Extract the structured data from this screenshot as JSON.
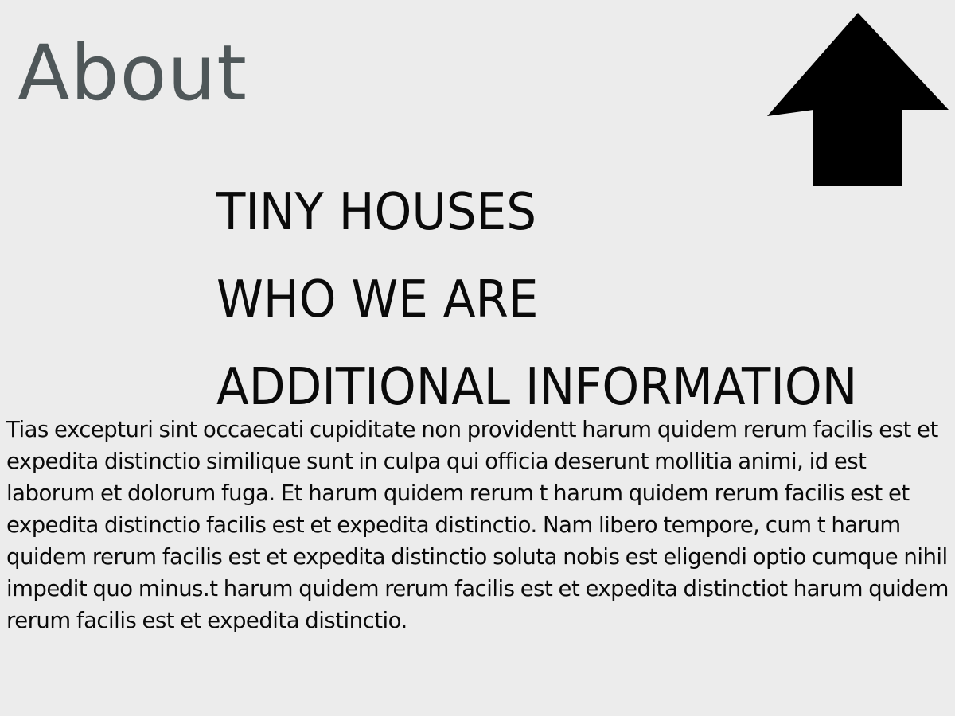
{
  "header": {
    "title": "About"
  },
  "icons": {
    "back_to_top": "arrow-up-icon",
    "arrow_color": "#000000"
  },
  "nav": {
    "items": [
      {
        "label": "TINY HOUSES"
      },
      {
        "label": "WHO WE ARE"
      },
      {
        "label": "ADDITIONAL INFORMATION"
      }
    ]
  },
  "content": {
    "paragraph": "Tias excepturi sint occaecati cupiditate non providentt harum quidem rerum facilis est et expedita distinctio similique sunt in culpa qui officia deserunt mollitia animi, id est laborum et dolorum fuga. Et harum quidem rerum t harum quidem rerum facilis est et expedita distinctio facilis est et expedita distinctio. Nam libero tempore, cum t harum quidem rerum  facilis est et expedita distinctio soluta nobis est eligendi optio cumque nihil impedit quo minus.t harum quidem rerum facilis est et expedita distinctiot harum quidem rerum facilis est et expedita distinctio."
  },
  "colors": {
    "background": "#ececec",
    "title": "#4f5759",
    "text": "#0a0a0a"
  }
}
